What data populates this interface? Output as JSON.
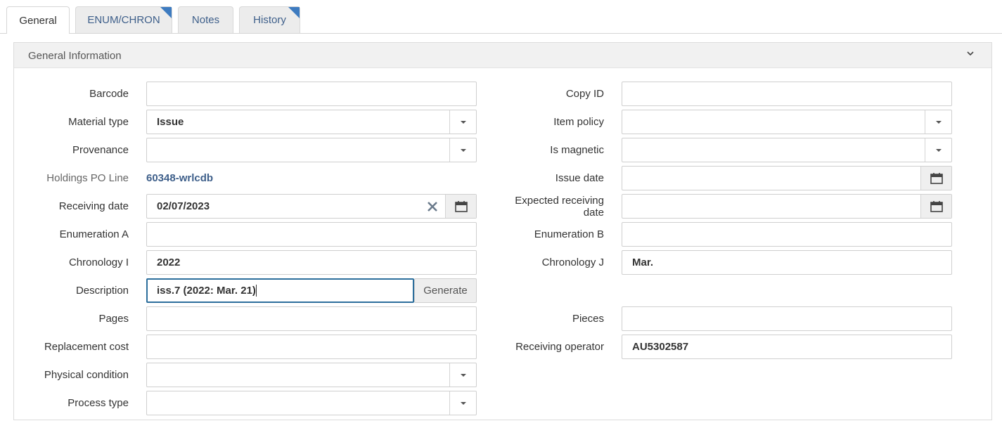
{
  "tabs": [
    {
      "label": "General",
      "active": true
    },
    {
      "label": "ENUM/CHRON",
      "has_corner": true
    },
    {
      "label": "Notes"
    },
    {
      "label": "History",
      "has_corner": true
    }
  ],
  "section": {
    "title": "General Information"
  },
  "left": {
    "barcode": {
      "label": "Barcode",
      "value": ""
    },
    "material_type": {
      "label": "Material type",
      "value": "Issue"
    },
    "provenance": {
      "label": "Provenance",
      "value": ""
    },
    "holdings_po_line": {
      "label": "Holdings PO Line",
      "value": "60348-wrlcdb"
    },
    "receiving_date": {
      "label": "Receiving date",
      "value": "02/07/2023"
    },
    "enumeration_a": {
      "label": "Enumeration A",
      "value": ""
    },
    "chronology_i": {
      "label": "Chronology I",
      "value": "2022"
    },
    "description": {
      "label": "Description",
      "value": "iss.7 (2022: Mar. 21)",
      "button": "Generate"
    },
    "pages": {
      "label": "Pages",
      "value": ""
    },
    "replacement_cost": {
      "label": "Replacement cost",
      "value": ""
    },
    "physical_condition": {
      "label": "Physical condition",
      "value": ""
    },
    "process_type": {
      "label": "Process type",
      "value": ""
    }
  },
  "right": {
    "copy_id": {
      "label": "Copy ID",
      "value": ""
    },
    "item_policy": {
      "label": "Item policy",
      "value": ""
    },
    "is_magnetic": {
      "label": "Is magnetic",
      "value": ""
    },
    "issue_date": {
      "label": "Issue date",
      "value": ""
    },
    "expected_receiving_date": {
      "label_line1": "Expected receiving",
      "label_line2": "date",
      "value": ""
    },
    "enumeration_b": {
      "label": "Enumeration B",
      "value": ""
    },
    "chronology_j": {
      "label": "Chronology J",
      "value": "Mar."
    },
    "pieces": {
      "label": "Pieces",
      "value": ""
    },
    "receiving_operator": {
      "label": "Receiving operator",
      "value": "AU5302587"
    }
  },
  "colors": {
    "accent": "#3e5f8a",
    "corner": "#3d7bc0",
    "focus": "#2c6e9c"
  }
}
